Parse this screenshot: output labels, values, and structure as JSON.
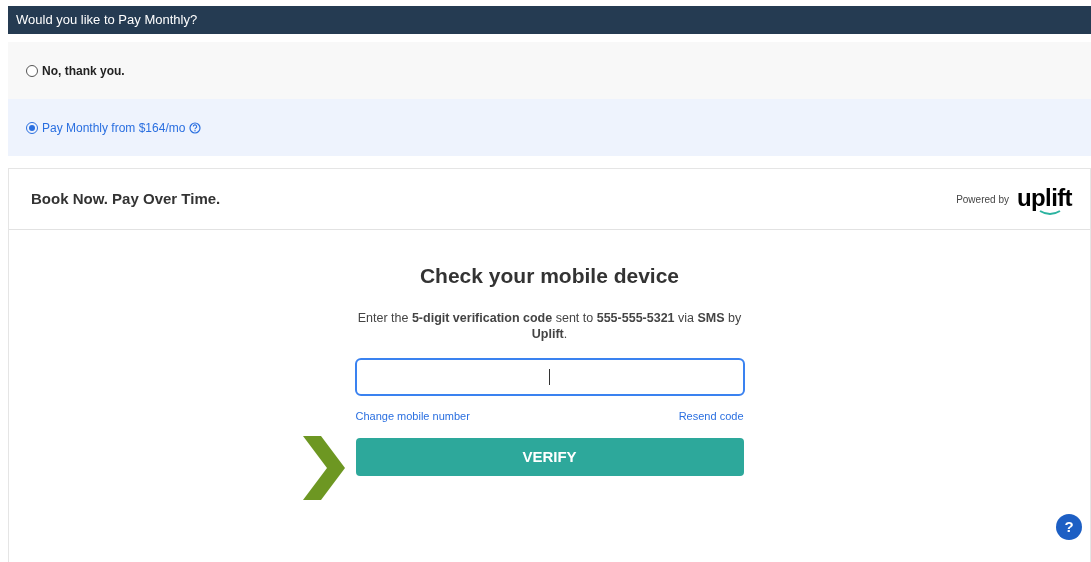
{
  "header": {
    "title": "Would you like to Pay Monthly?"
  },
  "options": [
    {
      "label": "No, thank you.",
      "selected": false,
      "help": false
    },
    {
      "label": "Pay Monthly from $164/mo",
      "selected": true,
      "help": true
    }
  ],
  "card": {
    "title": "Book Now. Pay Over Time.",
    "powered_by": "Powered by",
    "logo": "uplift"
  },
  "verify": {
    "heading": "Check your mobile device",
    "message": "Enter the **5-digit verification code** sent to **555-555-5321** via **SMS** by **Uplift**.",
    "links": [
      "Change mobile number",
      "Resend code"
    ],
    "button": "VERIFY"
  },
  "help_button": "?"
}
